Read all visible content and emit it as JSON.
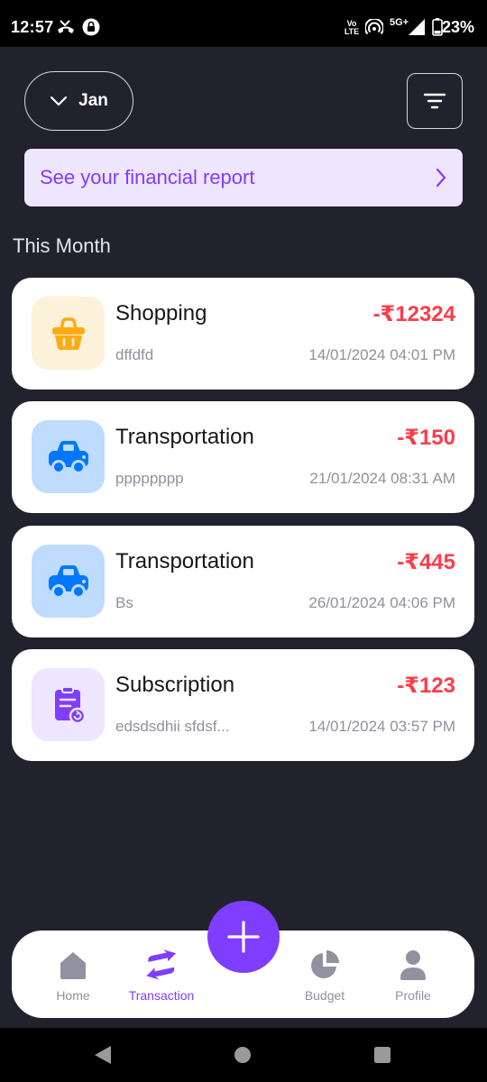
{
  "status_bar": {
    "time": "12:57",
    "volte": "Vo)) LTE",
    "network": "5G+",
    "battery": "23%"
  },
  "header": {
    "month_label": "Jan",
    "month_icon": "chevron-down-icon",
    "filter_icon": "filter-icon"
  },
  "report_banner": {
    "label": "See your financial report",
    "icon": "chevron-right-icon"
  },
  "section_title": "This Month",
  "transactions": [
    {
      "category": "Shopping",
      "description": "dffdfd",
      "amount": "-₹12324",
      "datetime": "14/01/2024 04:01 PM",
      "icon": "shopping-basket-icon",
      "icon_bg": "#fcf1d9",
      "icon_color": "#fcac12"
    },
    {
      "category": "Transportation",
      "description": "pppppppp",
      "amount": "-₹150",
      "datetime": "21/01/2024 08:31 AM",
      "icon": "car-icon",
      "icon_bg": "#bfdcff",
      "icon_color": "#0077ff"
    },
    {
      "category": "Transportation",
      "description": "Bs",
      "amount": "-₹445",
      "datetime": "26/01/2024 04:06 PM",
      "icon": "car-icon",
      "icon_bg": "#bfdcff",
      "icon_color": "#0077ff"
    },
    {
      "category": "Subscription",
      "description": "edsdsdhii sfdsf...",
      "amount": "-₹123",
      "datetime": "14/01/2024 03:57 PM",
      "icon": "subscription-icon",
      "icon_bg": "#eee5ff",
      "icon_color": "#7f3dff"
    }
  ],
  "bottom_nav": {
    "items": [
      {
        "label": "Home",
        "icon": "home-icon",
        "active": false
      },
      {
        "label": "Transaction",
        "icon": "transaction-icon",
        "active": true
      },
      {
        "label": "Budget",
        "icon": "pie-chart-icon",
        "active": false
      },
      {
        "label": "Profile",
        "icon": "user-icon",
        "active": false
      }
    ],
    "fab_icon": "plus-icon"
  },
  "colors": {
    "background": "#22222e",
    "accent": "#7f3dff",
    "expense": "#fd3c4a",
    "inactive": "#91919f"
  }
}
